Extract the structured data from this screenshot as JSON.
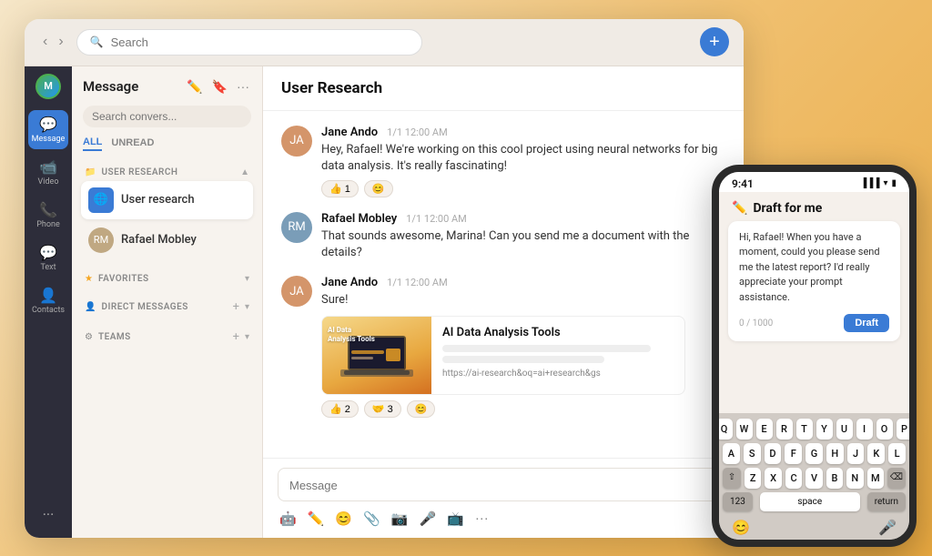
{
  "topbar": {
    "search_placeholder": "Search",
    "add_btn_label": "+"
  },
  "sidebar_nav": {
    "items": [
      {
        "id": "message",
        "label": "Message",
        "icon": "💬",
        "active": true
      },
      {
        "id": "video",
        "label": "Video",
        "icon": "📹"
      },
      {
        "id": "phone",
        "label": "Phone",
        "icon": "📞"
      },
      {
        "id": "text",
        "label": "Text",
        "icon": "💬"
      },
      {
        "id": "contacts",
        "label": "Contacts",
        "icon": "👤"
      }
    ]
  },
  "conv_panel": {
    "title": "Message",
    "search_placeholder": "Search convers...",
    "filter_all": "ALL",
    "filter_unread": "UNREAD",
    "sections": {
      "user_research": {
        "label": "USER RESEARCH",
        "items": [
          {
            "name": "User research",
            "icon": "🌐",
            "active": true
          },
          {
            "name": "Rafael Mobley",
            "type": "person"
          }
        ]
      },
      "favorites": {
        "label": "FAVORITES"
      },
      "direct_messages": {
        "label": "DIRECT MESSAGES"
      },
      "teams": {
        "label": "TEAMS"
      }
    }
  },
  "chat": {
    "title": "User Research",
    "messages": [
      {
        "id": 1,
        "sender": "Jane Ando",
        "avatar_initials": "JA",
        "time": "1/1 12:00 AM",
        "text": "Hey, Rafael! We're working on this cool project using neural networks for big data analysis. It's really fascinating!",
        "reactions": [
          {
            "emoji": "👍",
            "count": "1"
          },
          {
            "emoji": "😊",
            "count": ""
          }
        ]
      },
      {
        "id": 2,
        "sender": "Rafael Mobley",
        "avatar_initials": "RM",
        "time": "1/1 12:00 AM",
        "text": "That sounds awesome, Marina! Can you send me a document with the details?"
      },
      {
        "id": 3,
        "sender": "Jane Ando",
        "avatar_initials": "JA",
        "time": "1/1 12:00 AM",
        "text": "Sure!",
        "link_preview": {
          "title": "AI Data Analysis Tools",
          "url": "https://ai-research&oq=ai+research&gs",
          "img_label": "AI Data\nAnalysis Tools"
        },
        "reactions": [
          {
            "emoji": "👍",
            "count": "2"
          },
          {
            "emoji": "🤝",
            "count": "3"
          },
          {
            "emoji": "😊",
            "count": ""
          }
        ]
      }
    ],
    "input_placeholder": "Message",
    "input_tools": [
      "🤖",
      "✏️",
      "😊",
      "📎",
      "📷",
      "🎤",
      "📺",
      "···"
    ]
  },
  "phone": {
    "time": "9:41",
    "status_icons": "▐▐▐ ◀ ▮",
    "draft_title": "Draft for me",
    "draft_text": "Hi, Rafael! When you have a moment, could you please send me the latest report? I'd really appreciate your prompt assistance.",
    "draft_counter": "0 / 1000",
    "draft_btn": "Draft",
    "keyboard": {
      "row1": [
        "Q",
        "W",
        "E",
        "R",
        "T",
        "Y",
        "U",
        "I",
        "O",
        "P"
      ],
      "row2": [
        "A",
        "S",
        "D",
        "F",
        "G",
        "H",
        "J",
        "K",
        "L"
      ],
      "row3": [
        "Z",
        "X",
        "C",
        "V",
        "B",
        "N",
        "M"
      ],
      "num_key": "123",
      "space_key": "space",
      "return_key": "return"
    }
  }
}
